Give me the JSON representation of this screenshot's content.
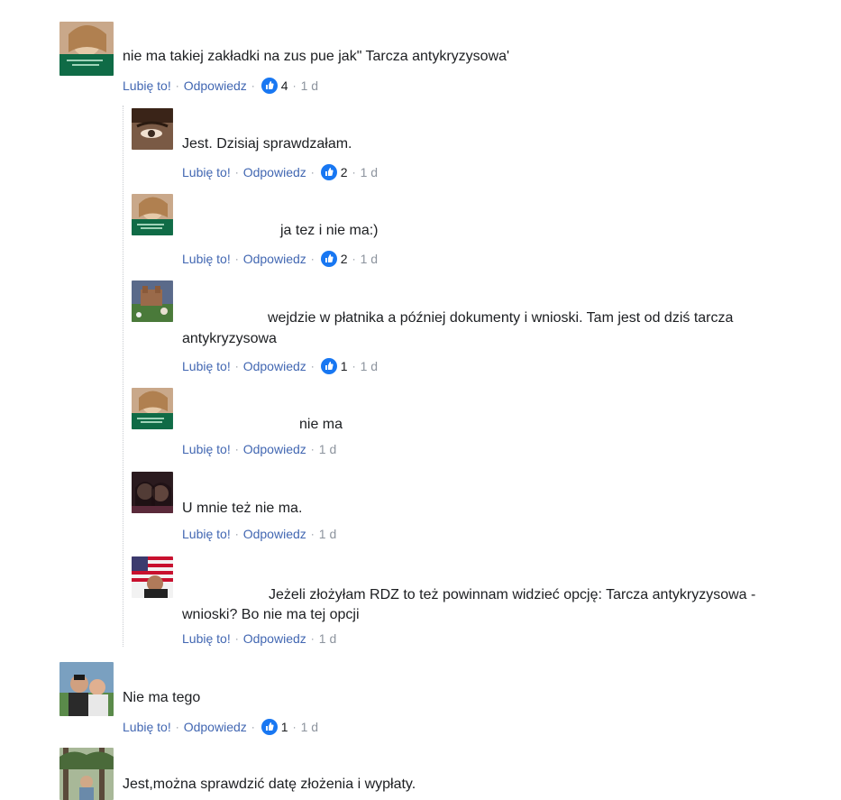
{
  "labels": {
    "like": "Lubię to!",
    "reply": "Odpowiedz",
    "dot": "·"
  },
  "colors": {
    "link": "#4267b2",
    "meta": "#8d949e",
    "like_badge": "#1877f2"
  },
  "comments": [
    {
      "text": "nie ma takiej zakładki na zus pue jak\" Tarcza antykryzysowa'",
      "likes": "4",
      "time": "1 d"
    },
    {
      "text": "Jest. Dzisiaj sprawdzałam.",
      "likes": "2",
      "time": "1 d"
    },
    {
      "text": "ja tez i nie ma:)",
      "likes": "2",
      "time": "1 d"
    },
    {
      "text": "wejdzie w płatnika a później dokumenty i wnioski. Tam jest od dziś tarcza",
      "text2": "antykryzysowa",
      "likes": "1",
      "time": "1 d"
    },
    {
      "text": "nie ma",
      "time": "1 d"
    },
    {
      "text": "U mnie też nie ma.",
      "time": "1 d"
    },
    {
      "text": "Jeżeli złożyłam RDZ to też powinnam widzieć opcję: Tarcza antykryzysowa -",
      "text2": "wnioski? Bo nie ma tej opcji",
      "time": "1 d"
    },
    {
      "text": "Nie ma tego",
      "likes": "1",
      "time": "1 d"
    },
    {
      "text": "Jest,można sprawdzić datę złożenia i wypłaty."
    }
  ]
}
